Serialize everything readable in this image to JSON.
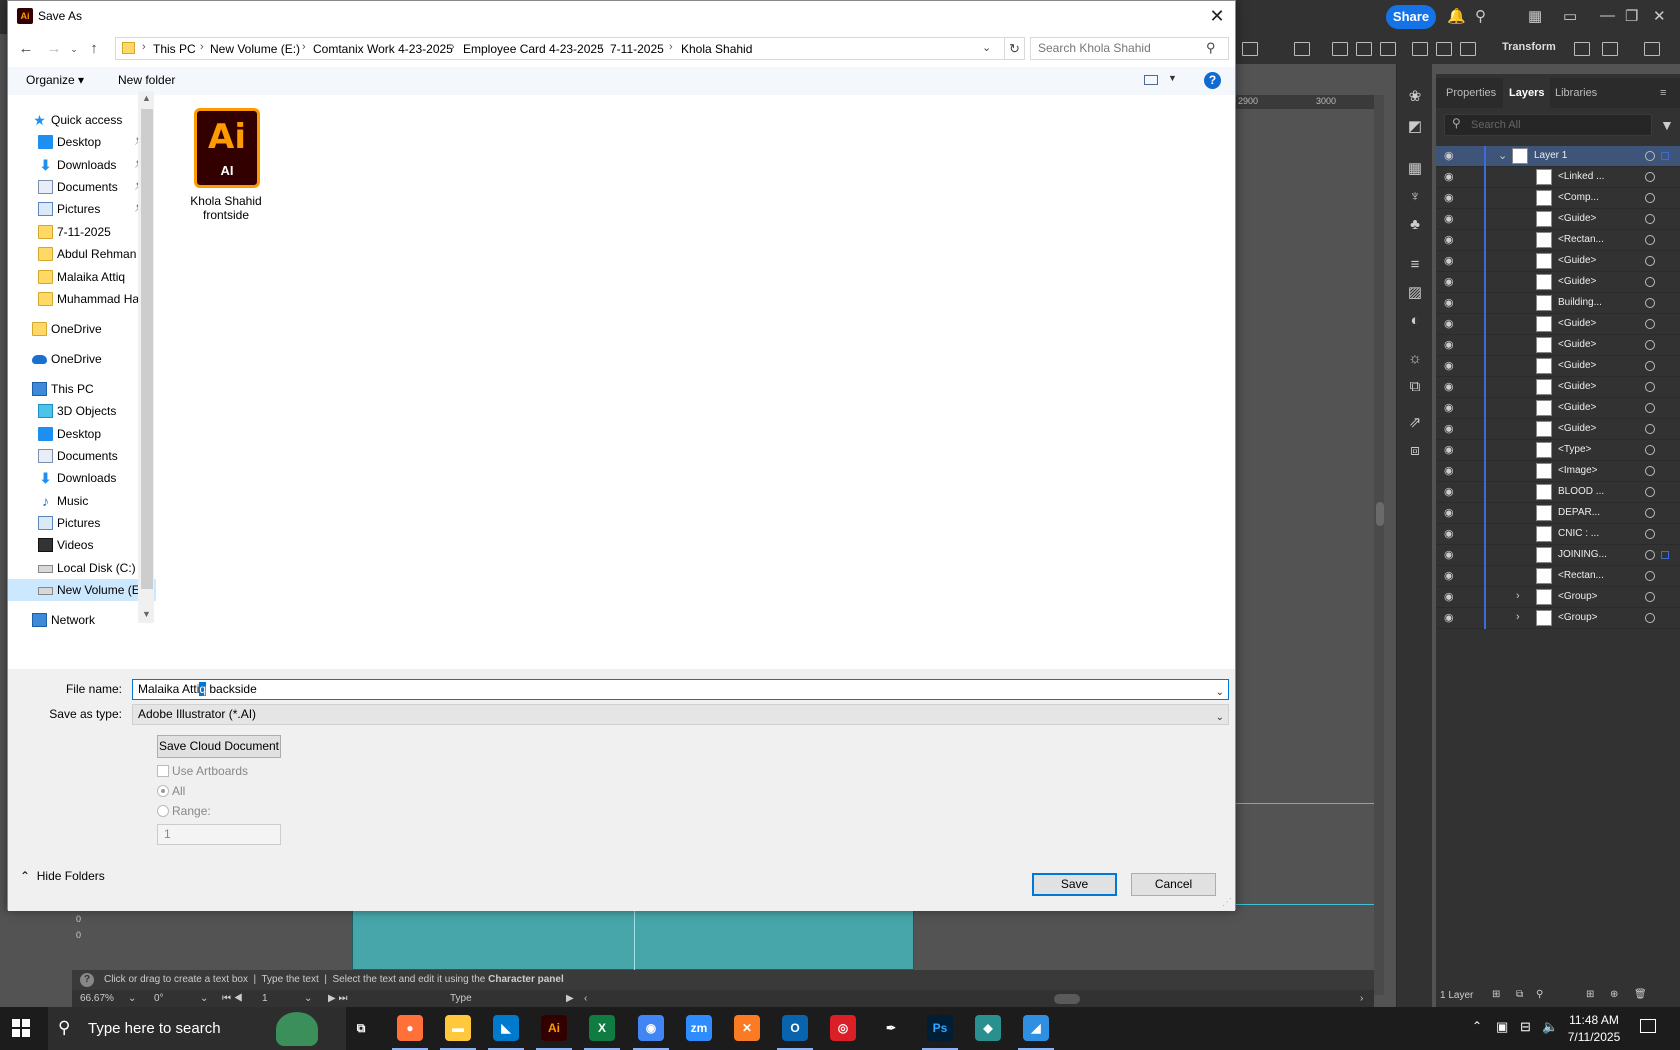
{
  "dialog": {
    "title": "Save As",
    "breadcrumb": [
      "This PC",
      "New Volume (E:)",
      "Comtanix Work 4-23-2025",
      "Employee Card 4-23-2025",
      "7-11-2025",
      "Khola Shahid"
    ],
    "search_placeholder": "Search Khola Shahid",
    "organize_label": "Organize",
    "new_folder_label": "New folder",
    "nav_items": [
      {
        "label": "Quick access",
        "icon": "star-icon"
      },
      {
        "label": "Desktop",
        "icon": "desktop-icon",
        "pinned": true
      },
      {
        "label": "Downloads",
        "icon": "downloads-icon",
        "pinned": true
      },
      {
        "label": "Documents",
        "icon": "documents-icon",
        "pinned": true
      },
      {
        "label": "Pictures",
        "icon": "pictures-icon",
        "pinned": true
      },
      {
        "label": "7-11-2025",
        "icon": "folder-icon"
      },
      {
        "label": "Abdul Rehman",
        "icon": "folder-icon"
      },
      {
        "label": "Malaika Attiq",
        "icon": "folder-icon"
      },
      {
        "label": "Muhammad Hai",
        "icon": "folder-icon"
      },
      {
        "label": "OneDrive",
        "icon": "folder-icon"
      },
      {
        "label": "OneDrive",
        "icon": "cloud-icon"
      },
      {
        "label": "This PC",
        "icon": "pc-icon"
      },
      {
        "label": "3D Objects",
        "icon": "cube-icon"
      },
      {
        "label": "Desktop",
        "icon": "desktop-icon"
      },
      {
        "label": "Documents",
        "icon": "documents-icon"
      },
      {
        "label": "Downloads",
        "icon": "downloads-icon"
      },
      {
        "label": "Music",
        "icon": "music-icon"
      },
      {
        "label": "Pictures",
        "icon": "pictures-icon"
      },
      {
        "label": "Videos",
        "icon": "videos-icon"
      },
      {
        "label": "Local Disk (C:)",
        "icon": "disk-icon"
      },
      {
        "label": "New Volume (E:)",
        "icon": "disk-icon",
        "selected": true
      },
      {
        "label": "Network",
        "icon": "network-icon"
      }
    ],
    "file": {
      "icon_big": "Ai",
      "icon_small": "AI",
      "name": "Khola Shahid frontside"
    },
    "file_name_label": "File name:",
    "file_name_before": "Malaika Atti",
    "file_name_selected": "q",
    "file_name_after": " backside",
    "save_type_label": "Save as type:",
    "save_type_value": "Adobe Illustrator (*.AI)",
    "save_cloud_label": "Save Cloud Document",
    "use_artboards_label": "Use Artboards",
    "all_label": "All",
    "range_label": "Range:",
    "range_value": "1",
    "hide_folders_label": "Hide Folders",
    "save_label": "Save",
    "cancel_label": "Cancel"
  },
  "illustrator": {
    "share_label": "Share",
    "transform_label": "Transform",
    "ruler_labels": [
      "2900",
      "3000"
    ],
    "tabs": [
      "Properties",
      "Layers",
      "Libraries"
    ],
    "layer_search_placeholder": "Search All",
    "layers": [
      {
        "name": "Layer 1",
        "top": true
      },
      {
        "name": "<Linked ..."
      },
      {
        "name": "<Comp..."
      },
      {
        "name": "<Guide>"
      },
      {
        "name": "<Rectan..."
      },
      {
        "name": "<Guide>"
      },
      {
        "name": "<Guide>"
      },
      {
        "name": "Building..."
      },
      {
        "name": "<Guide>"
      },
      {
        "name": "<Guide>"
      },
      {
        "name": "<Guide>"
      },
      {
        "name": "<Guide>"
      },
      {
        "name": "<Guide>"
      },
      {
        "name": "<Guide>"
      },
      {
        "name": "<Type>"
      },
      {
        "name": "<Image>"
      },
      {
        "name": "BLOOD ..."
      },
      {
        "name": "DEPAR..."
      },
      {
        "name": "CNIC : ..."
      },
      {
        "name": "JOINING..."
      },
      {
        "name": "<Rectan..."
      },
      {
        "name": "<Group>",
        "expandable": true
      },
      {
        "name": "<Group>",
        "expandable": true
      }
    ],
    "layers_count": "1 Layer",
    "status_hint_1": "Click or drag to create a text box",
    "status_hint_2": "Type the text",
    "status_hint_3": "Select the text and edit it using the",
    "status_hint_4": "Character panel",
    "zoom": "66.67%",
    "rotation": "0°",
    "artboard_num": "1",
    "tool_name": "Type",
    "ruler_small_1": "0",
    "ruler_small_2": "0"
  },
  "taskbar": {
    "search_placeholder": "Type here to search",
    "time": "11:48 AM",
    "date": "7/11/2025",
    "apps": [
      {
        "name": "task-view",
        "glyph": "⧉",
        "color": "#1c1c1c"
      },
      {
        "name": "firefox",
        "glyph": "●",
        "color": "#ff7139"
      },
      {
        "name": "file-explorer",
        "glyph": "▬",
        "color": "#ffc83d"
      },
      {
        "name": "vscode",
        "glyph": "◣",
        "color": "#007acc"
      },
      {
        "name": "illustrator",
        "glyph": "Ai",
        "color": "#330000"
      },
      {
        "name": "excel",
        "glyph": "X",
        "color": "#107c41"
      },
      {
        "name": "chrome",
        "glyph": "◉",
        "color": "#4285f4"
      },
      {
        "name": "zoom",
        "glyph": "zm",
        "color": "#2d8cff"
      },
      {
        "name": "xampp",
        "glyph": "✕",
        "color": "#fb7a24"
      },
      {
        "name": "outlook",
        "glyph": "O",
        "color": "#0a64ad"
      },
      {
        "name": "creative-cloud",
        "glyph": "◎",
        "color": "#da1f26"
      },
      {
        "name": "pen-tool",
        "glyph": "✒",
        "color": "#1c1c1c"
      },
      {
        "name": "photoshop",
        "glyph": "Ps",
        "color": "#001e36"
      },
      {
        "name": "app-diamond",
        "glyph": "◆",
        "color": "#2a8f8f"
      },
      {
        "name": "paint-app",
        "glyph": "◢",
        "color": "#2f8fe0"
      }
    ]
  },
  "colors": {
    "accent": "#0078d7",
    "artboard": "#46a6aa",
    "share": "#1473e6"
  }
}
